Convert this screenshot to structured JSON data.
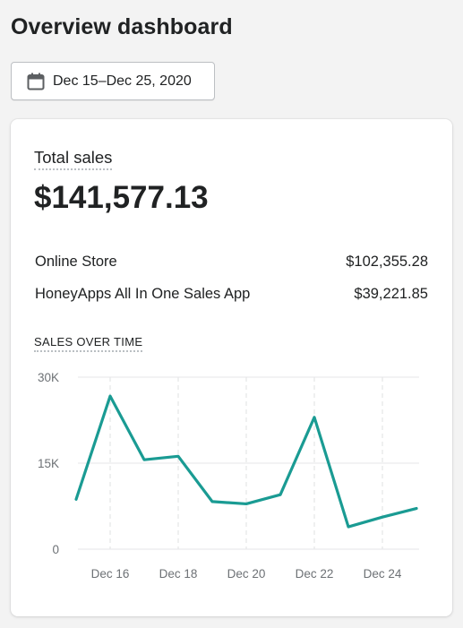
{
  "page": {
    "title": "Overview dashboard"
  },
  "date_picker": {
    "icon": "calendar-icon",
    "label": "Dec 15–Dec 25, 2020"
  },
  "total_sales": {
    "title": "Total sales",
    "value": "$141,577.13",
    "channels": [
      {
        "name": "Online Store",
        "amount": "$102,355.28"
      },
      {
        "name": "HoneyApps All In One Sales App",
        "amount": "$39,221.85"
      }
    ]
  },
  "sales_over_time": {
    "title": "SALES OVER TIME"
  },
  "colors": {
    "line": "#1a9b93",
    "grid": "#e4e5e7",
    "background": "#f3f3f3"
  },
  "chart_data": {
    "type": "line",
    "x": [
      "Dec 15",
      "Dec 16",
      "Dec 17",
      "Dec 18",
      "Dec 19",
      "Dec 20",
      "Dec 21",
      "Dec 22",
      "Dec 23",
      "Dec 24",
      "Dec 25"
    ],
    "series": [
      {
        "values": [
          8700,
          26700,
          15600,
          16200,
          8300,
          7900,
          9500,
          23000,
          3900,
          5600,
          7100
        ]
      }
    ],
    "x_tick_labels": [
      "Dec 16",
      "Dec 18",
      "Dec 20",
      "Dec 22",
      "Dec 24"
    ],
    "y_ticks": [
      "30K",
      "15K",
      "0"
    ],
    "ylim": [
      0,
      30000
    ],
    "grid": true
  }
}
